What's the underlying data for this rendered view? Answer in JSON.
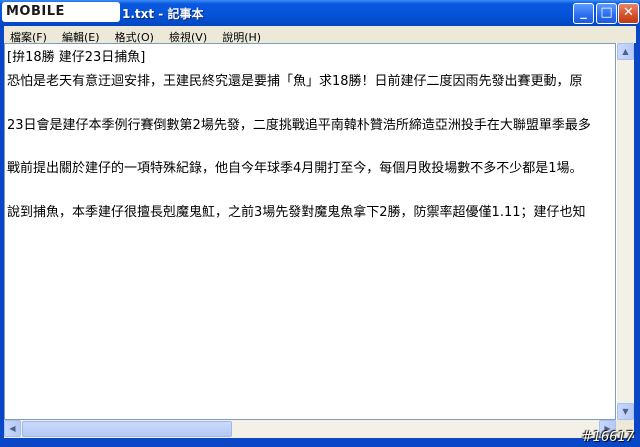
{
  "window": {
    "logo_text": "MOBILE",
    "title": "1.txt - 記事本",
    "buttons": {
      "minimize": "_",
      "maximize": "□",
      "close": "✕"
    }
  },
  "menubar": {
    "items": [
      {
        "label": "檔案(F)"
      },
      {
        "label": "編輯(E)"
      },
      {
        "label": "格式(O)"
      },
      {
        "label": "檢視(V)"
      },
      {
        "label": "說明(H)"
      }
    ]
  },
  "document": {
    "lines": [
      "[拚18勝 建仔23日捕魚]",
      "恐怕是老天有意迂迴安排，王建民終究還是要捕「魚」求18勝！日前建仔二度因雨先發出賽更動，原",
      "23日會是建仔本季例行賽倒數第2場先發，二度挑戰追平南韓朴贊浩所締造亞洲投手在大聯盟單季最多",
      "戰前提出關於建仔的一項特殊紀錄，他自今年球季4月開打至今，每個月敗投場數不多不少都是1場。",
      "說到捕魚，本季建仔很擅長剋魔鬼魟，之前3場先發對魔鬼魚拿下2勝，防禦率超優僅1.11；建仔也知"
    ]
  },
  "watermark": "#16617",
  "colors": {
    "titlebar": "#0553d6",
    "chrome": "#ece9d8",
    "editor_bg": "#ffffff"
  }
}
